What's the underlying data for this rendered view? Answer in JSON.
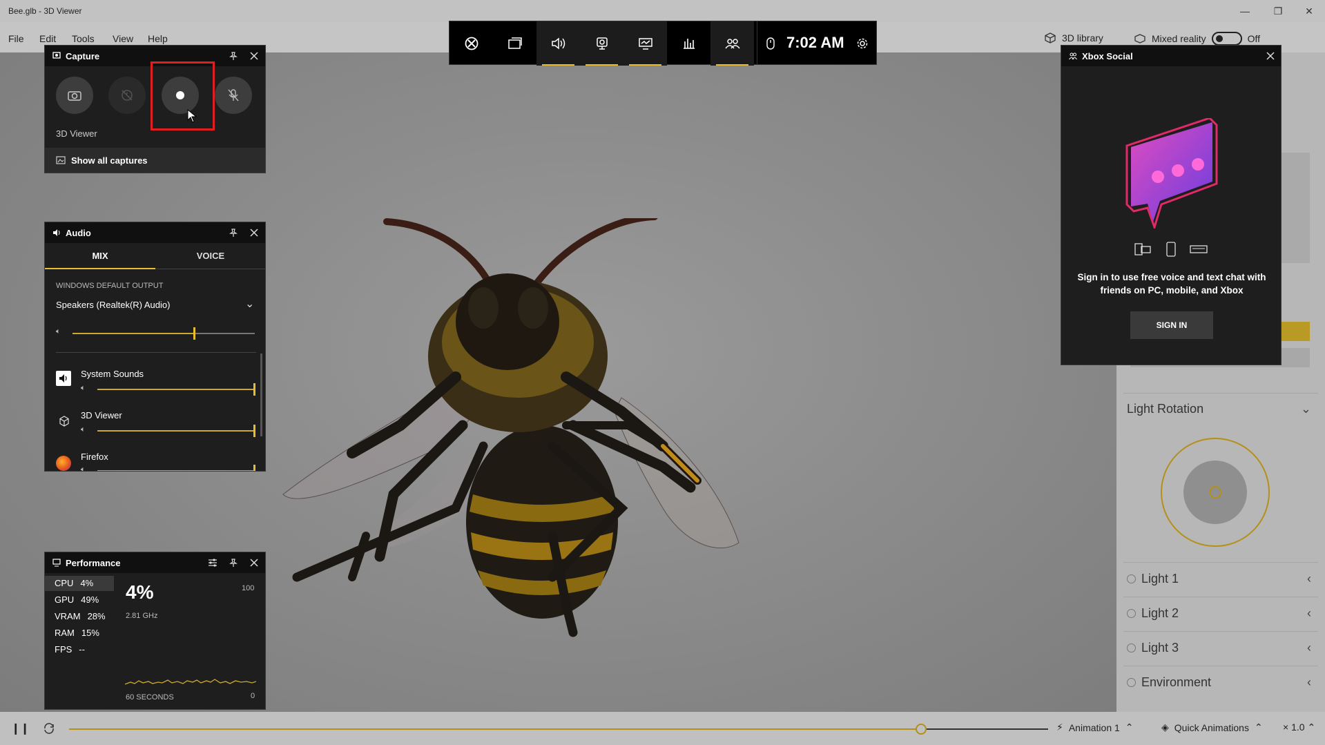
{
  "window": {
    "title": "Bee.glb - 3D Viewer",
    "controls": {
      "minimize": "—",
      "restore": "❐",
      "close": "✕"
    }
  },
  "menu": {
    "items": [
      "File",
      "Edit",
      "Tools",
      "View",
      "Help"
    ],
    "library": "3D library",
    "mixed_reality": "Mixed reality",
    "mixed_reality_state": "Off"
  },
  "gamebar": {
    "time": "7:02 AM",
    "buttons": [
      "xbox-icon",
      "widget-menu-icon",
      "audio-icon",
      "capture-icon",
      "performance-icon",
      "resources-icon",
      "xbox-social-icon"
    ]
  },
  "capture": {
    "title": "Capture",
    "app_label": "3D Viewer",
    "show_all": "Show all captures"
  },
  "audio": {
    "title": "Audio",
    "tabs": [
      "MIX",
      "VOICE"
    ],
    "output_label": "WINDOWS DEFAULT OUTPUT",
    "device": "Speakers (Realtek(R) Audio)",
    "master_level": 0.67,
    "apps": [
      {
        "name": "System Sounds",
        "level": 1.0
      },
      {
        "name": "3D Viewer",
        "level": 1.0
      },
      {
        "name": "Firefox",
        "level": 1.0
      }
    ]
  },
  "performance": {
    "title": "Performance",
    "metrics": [
      {
        "label": "CPU",
        "value": "4%"
      },
      {
        "label": "GPU",
        "value": "49%"
      },
      {
        "label": "VRAM",
        "value": "28%"
      },
      {
        "label": "RAM",
        "value": "15%"
      },
      {
        "label": "FPS",
        "value": "--"
      }
    ],
    "big_value": "4%",
    "frequency": "2.81 GHz",
    "scale_max": "100",
    "scale_min": "0",
    "window_label": "60 SECONDS"
  },
  "social": {
    "title": "Xbox Social",
    "message": "Sign in to use free voice and text chat with friends on PC, mobile, and Xbox",
    "sign_in": "SIGN IN"
  },
  "right_panel": {
    "light_rotation": "Light Rotation",
    "lights": [
      "Light 1",
      "Light 2",
      "Light 3",
      "Environment"
    ]
  },
  "bottom": {
    "animation": "Animation 1",
    "quick_animations": "Quick Animations",
    "speed": "× 1.0",
    "timeline_position": 0.87
  },
  "colors": {
    "accent": "#e8bd2e",
    "highlight": "#e02020",
    "widget_bg": "#1e1e1e"
  }
}
